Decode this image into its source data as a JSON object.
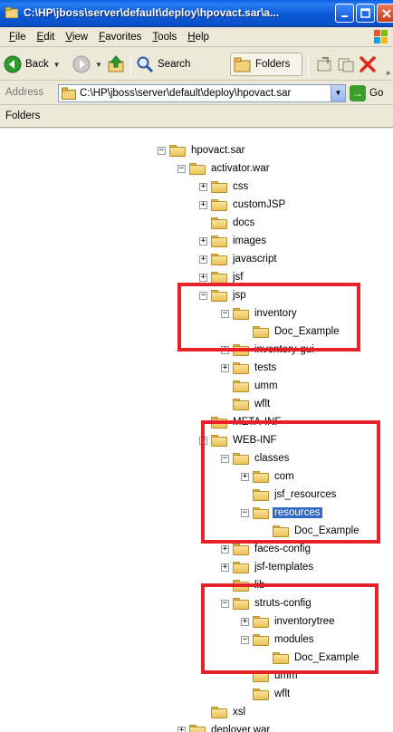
{
  "window": {
    "title": "C:\\HP\\jboss\\server\\default\\deploy\\hpovact.sar\\a..."
  },
  "menu": [
    "File",
    "Edit",
    "View",
    "Favorites",
    "Tools",
    "Help"
  ],
  "toolbar": {
    "back_label": "Back",
    "search_label": "Search",
    "folders_label": "Folders"
  },
  "address": {
    "label": "Address",
    "value": "C:\\HP\\jboss\\server\\default\\deploy\\hpovact.sar",
    "go_label": "Go"
  },
  "pane": {
    "title": "Folders"
  },
  "tree": [
    {
      "label": "hpovact.sar",
      "expander": "minus"
    },
    {
      "label": "activator.war",
      "expander": "minus"
    },
    {
      "label": "css",
      "expander": "plus"
    },
    {
      "label": "customJSP",
      "expander": "plus"
    },
    {
      "label": "docs",
      "expander": "none"
    },
    {
      "label": "images",
      "expander": "plus"
    },
    {
      "label": "javascript",
      "expander": "plus"
    },
    {
      "label": "jsf",
      "expander": "plus"
    },
    {
      "label": "jsp",
      "expander": "minus"
    },
    {
      "label": "inventory",
      "expander": "minus"
    },
    {
      "label": "Doc_Example",
      "expander": "none"
    },
    {
      "label": "inventory-gui",
      "expander": "plus"
    },
    {
      "label": "tests",
      "expander": "plus"
    },
    {
      "label": "umm",
      "expander": "none"
    },
    {
      "label": "wflt",
      "expander": "none"
    },
    {
      "label": "META-INF",
      "expander": "none"
    },
    {
      "label": "WEB-INF",
      "expander": "minus"
    },
    {
      "label": "classes",
      "expander": "minus"
    },
    {
      "label": "com",
      "expander": "plus"
    },
    {
      "label": "jsf_resources",
      "expander": "none"
    },
    {
      "label": "resources",
      "expander": "minus",
      "selected": true
    },
    {
      "label": "Doc_Example",
      "expander": "none"
    },
    {
      "label": "faces-config",
      "expander": "plus"
    },
    {
      "label": "jsf-templates",
      "expander": "plus"
    },
    {
      "label": "lib",
      "expander": "none"
    },
    {
      "label": "struts-config",
      "expander": "minus"
    },
    {
      "label": "inventorytree",
      "expander": "plus"
    },
    {
      "label": "modules",
      "expander": "minus"
    },
    {
      "label": "Doc_Example",
      "expander": "none"
    },
    {
      "label": "umm",
      "expander": "none"
    },
    {
      "label": "wflt",
      "expander": "none"
    },
    {
      "label": "xsl",
      "expander": "none"
    },
    {
      "label": "deployer.war",
      "expander": "plus"
    }
  ],
  "colors": {
    "titlebar": "#0a5fe0",
    "highlight_box": "#e8202a",
    "selection": "#316ac5"
  }
}
